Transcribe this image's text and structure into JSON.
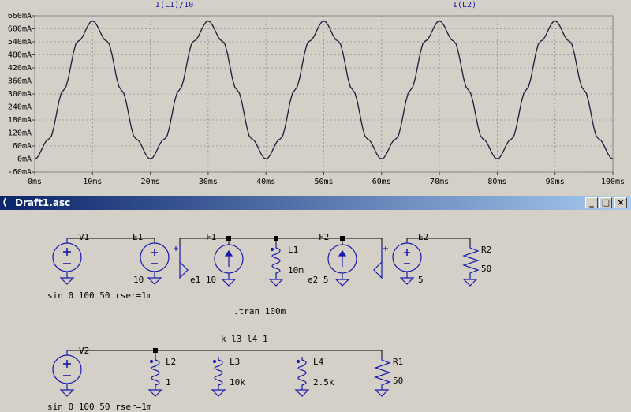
{
  "plot": {
    "trace_labels": [
      "I(L1)/10",
      "I(L2)"
    ],
    "chart_data": {
      "type": "line",
      "xlabel": "",
      "ylabel": "",
      "x_unit": "ms",
      "xlim": [
        0,
        100
      ],
      "ylim": [
        -60,
        660
      ],
      "x_ticks": [
        "0ms",
        "10ms",
        "20ms",
        "30ms",
        "40ms",
        "50ms",
        "60ms",
        "70ms",
        "80ms",
        "90ms",
        "100ms"
      ],
      "y_ticks": [
        "-60mA",
        "0mA",
        "60mA",
        "120mA",
        "180mA",
        "240mA",
        "300mA",
        "360mA",
        "420mA",
        "480mA",
        "540mA",
        "600mA",
        "660mA"
      ],
      "grid": true,
      "series": [
        {
          "name": "I(L2)",
          "color": "#1b1b3a",
          "x": [
            0,
            2.5,
            5,
            7.5,
            10,
            12.5,
            15,
            17.5,
            20,
            22.5,
            25,
            27.5,
            30,
            32.5,
            35,
            37.5,
            40,
            42.5,
            45,
            47.5,
            50,
            52.5,
            55,
            57.5,
            60,
            62.5,
            65,
            67.5,
            70,
            72.5,
            75,
            77.5,
            80,
            82.5,
            85,
            87.5,
            90,
            92.5,
            95,
            97.5,
            100
          ],
          "y": [
            0,
            93,
            318,
            543,
            636,
            543,
            318,
            93,
            0,
            93,
            318,
            543,
            636,
            543,
            318,
            93,
            0,
            93,
            318,
            543,
            636,
            543,
            318,
            93,
            0,
            93,
            318,
            543,
            636,
            543,
            318,
            93,
            0,
            93,
            318,
            543,
            636,
            543,
            318,
            93,
            0
          ]
        }
      ]
    }
  },
  "window": {
    "title": "Draft1.asc",
    "icon": "app-icon",
    "minimize": "_",
    "restore": "□",
    "close": "×"
  },
  "schematic": {
    "labels": {
      "v1": "V1",
      "e1": "E1",
      "e1_gain": "10",
      "f1": "F1",
      "f1_value": "e1 10",
      "l1": "L1",
      "l1_value": "10m",
      "f2": "F2",
      "f2_value": "e2 5",
      "e2": "E2",
      "e2_gain": "5",
      "r2": "R2",
      "r2_value": "50",
      "v1_value": "sin 0 100 50 rser=1m",
      "tran": ".tran 100m",
      "coupling": "k l3 l4 1",
      "v2": "V2",
      "v2_value": "sin 0 100 50 rser=1m",
      "l2": "L2",
      "l2_value": "1",
      "l3": "L3",
      "l3_value": "10k",
      "l4": "L4",
      "l4_value": "2.5k",
      "r1": "R1",
      "r1_value": "50"
    },
    "colors": {
      "wire": "#000000",
      "component": "#1a1aaa",
      "node": "#000000"
    }
  }
}
